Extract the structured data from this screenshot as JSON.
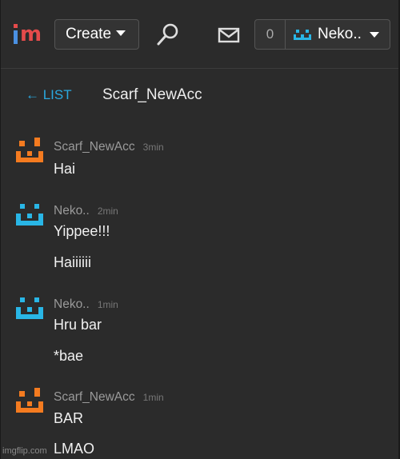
{
  "header": {
    "logo_text": "im",
    "create_label": "Create",
    "notification_count": "0",
    "username": "Neko.."
  },
  "conversation": {
    "back_label": "← LIST",
    "title": "Scarf_NewAcc"
  },
  "messages": [
    {
      "sender": "Scarf_NewAcc",
      "time": "3min",
      "avatar": "orange-pixel-face-icon",
      "lines": [
        "Hai"
      ]
    },
    {
      "sender": "Neko..",
      "time": "2min",
      "avatar": "blue-pixel-face-icon",
      "lines": [
        "Yippee!!!",
        "Haiiiiii"
      ]
    },
    {
      "sender": "Neko..",
      "time": "1min",
      "avatar": "blue-pixel-face-icon",
      "lines": [
        "Hru bar",
        "*bae"
      ]
    },
    {
      "sender": "Scarf_NewAcc",
      "time": "1min",
      "avatar": "orange-pixel-face-icon",
      "lines": [
        "BAR",
        "LMAO"
      ]
    }
  ],
  "watermark": "imgflip.com",
  "colors": {
    "background": "#2b2b2b",
    "link": "#2aa9e0",
    "orange_avatar": "#f47b20",
    "blue_avatar": "#29b6e6",
    "logo_red": "#e54b4b",
    "logo_blue": "#4a90e2"
  }
}
